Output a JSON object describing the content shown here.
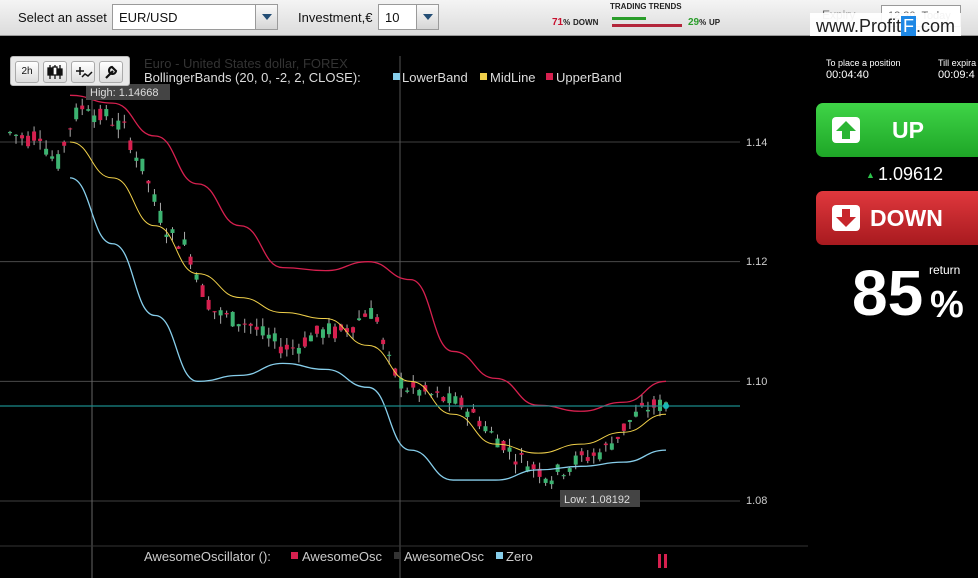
{
  "topbar": {
    "asset_label": "Select an asset",
    "asset_value": "EUR/USD",
    "investment_label": "Investment,€",
    "investment_value": "10",
    "trends_title": "TRADING TRENDS",
    "down_pct": "71",
    "down_label": "DOWN",
    "up_pct": "29",
    "up_label": "UP",
    "expiry_label": "Expiry",
    "expiry_value": "12:30, Today",
    "watermark_pre": "www.Profit",
    "watermark_f": "F",
    "watermark_post": ".com"
  },
  "toolbar": {
    "period_label": "2h"
  },
  "chart": {
    "title": "Euro - United States dollar, FOREX",
    "indicator_label": "BollingerBands (20, 0, -2, 2, CLOSE):",
    "legend": [
      {
        "name": "LowerBand",
        "color": "#87ceeb"
      },
      {
        "name": "MidLine",
        "color": "#f0d04a"
      },
      {
        "name": "UpperBand",
        "color": "#d6204f"
      }
    ],
    "high_label": "High: 1.14668",
    "low_label": "Low: 1.08192",
    "y_ticks": [
      "1.14",
      "1.12",
      "1.10",
      "1.08"
    ],
    "osc_label": "AwesomeOscillator ():",
    "osc_legend": [
      {
        "name": "AwesomeOsc",
        "color": "#d6204f"
      },
      {
        "name": "AwesomeOsc",
        "color": "#333333"
      },
      {
        "name": "Zero",
        "color": "#87ceeb"
      }
    ],
    "colors": {
      "up": "#3cb371",
      "down": "#d6204f",
      "grid": "#555555",
      "current_line": "#1a8a8a"
    }
  },
  "chart_data": {
    "type": "line",
    "title": "Euro - United States dollar, FOREX",
    "ylim": [
      1.08,
      1.14
    ],
    "y_ticks": [
      1.14,
      1.12,
      1.1,
      1.08
    ],
    "series": [
      {
        "name": "UpperBand",
        "values": [
          1.1478,
          1.1465,
          1.141,
          1.133,
          1.126,
          1.119,
          1.1185,
          1.12,
          1.117,
          1.105,
          1.1005,
          1.096,
          1.095,
          1.0965,
          1.1
        ]
      },
      {
        "name": "MidLine",
        "values": [
          1.14,
          1.134,
          1.126,
          1.118,
          1.114,
          1.1115,
          1.1105,
          1.106,
          1.1,
          1.0945,
          1.0895,
          1.088,
          1.0895,
          1.0915,
          1.0945
        ]
      },
      {
        "name": "LowerBand",
        "values": [
          1.134,
          1.123,
          1.111,
          1.1,
          1.101,
          1.103,
          1.102,
          1.099,
          1.0885,
          1.0835,
          1.0835,
          1.0852,
          1.0858,
          1.0865,
          1.0885
        ]
      }
    ],
    "high": 1.14668,
    "low": 1.08192,
    "current": 1.09612
  },
  "panel": {
    "place_label": "To place a position",
    "place_time": "00:04:40",
    "expiry_label": "Till expira",
    "expiry_time": "00:09:4",
    "up_label": "UP",
    "price": "1.09612",
    "down_label": "DOWN",
    "return_pct": "85",
    "return_sign": "%",
    "return_label": "return"
  }
}
